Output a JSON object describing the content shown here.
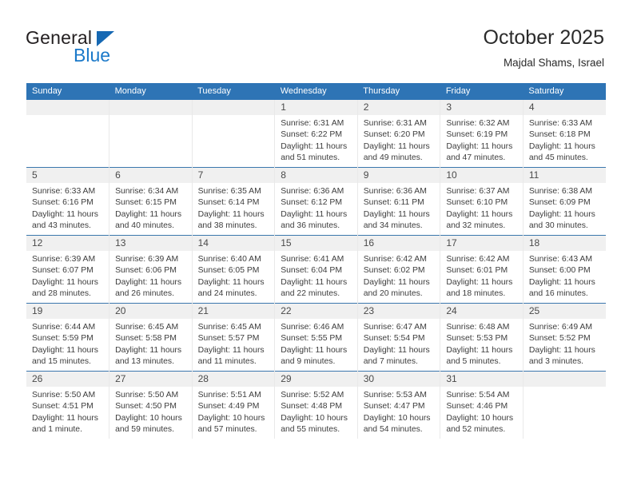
{
  "brand": {
    "name_top": "General",
    "name_bottom": "Blue",
    "triangle_color": "#1668b3",
    "blue_text_color": "#1b79c9"
  },
  "header": {
    "title": "October 2025",
    "subtitle": "Majdal Shams, Israel"
  },
  "theme": {
    "header_blue": "#2e74b5",
    "row_divider": "#3b77ad",
    "daynum_band": "#f0f0f0"
  },
  "weekdays": [
    "Sunday",
    "Monday",
    "Tuesday",
    "Wednesday",
    "Thursday",
    "Friday",
    "Saturday"
  ],
  "weeks": [
    [
      {
        "day": "",
        "blank": true
      },
      {
        "day": "",
        "blank": true
      },
      {
        "day": "",
        "blank": true
      },
      {
        "day": "1",
        "sunrise": "Sunrise: 6:31 AM",
        "sunset": "Sunset: 6:22 PM",
        "daylight_1": "Daylight: 11 hours",
        "daylight_2": "and 51 minutes."
      },
      {
        "day": "2",
        "sunrise": "Sunrise: 6:31 AM",
        "sunset": "Sunset: 6:20 PM",
        "daylight_1": "Daylight: 11 hours",
        "daylight_2": "and 49 minutes."
      },
      {
        "day": "3",
        "sunrise": "Sunrise: 6:32 AM",
        "sunset": "Sunset: 6:19 PM",
        "daylight_1": "Daylight: 11 hours",
        "daylight_2": "and 47 minutes."
      },
      {
        "day": "4",
        "sunrise": "Sunrise: 6:33 AM",
        "sunset": "Sunset: 6:18 PM",
        "daylight_1": "Daylight: 11 hours",
        "daylight_2": "and 45 minutes."
      }
    ],
    [
      {
        "day": "5",
        "sunrise": "Sunrise: 6:33 AM",
        "sunset": "Sunset: 6:16 PM",
        "daylight_1": "Daylight: 11 hours",
        "daylight_2": "and 43 minutes."
      },
      {
        "day": "6",
        "sunrise": "Sunrise: 6:34 AM",
        "sunset": "Sunset: 6:15 PM",
        "daylight_1": "Daylight: 11 hours",
        "daylight_2": "and 40 minutes."
      },
      {
        "day": "7",
        "sunrise": "Sunrise: 6:35 AM",
        "sunset": "Sunset: 6:14 PM",
        "daylight_1": "Daylight: 11 hours",
        "daylight_2": "and 38 minutes."
      },
      {
        "day": "8",
        "sunrise": "Sunrise: 6:36 AM",
        "sunset": "Sunset: 6:12 PM",
        "daylight_1": "Daylight: 11 hours",
        "daylight_2": "and 36 minutes."
      },
      {
        "day": "9",
        "sunrise": "Sunrise: 6:36 AM",
        "sunset": "Sunset: 6:11 PM",
        "daylight_1": "Daylight: 11 hours",
        "daylight_2": "and 34 minutes."
      },
      {
        "day": "10",
        "sunrise": "Sunrise: 6:37 AM",
        "sunset": "Sunset: 6:10 PM",
        "daylight_1": "Daylight: 11 hours",
        "daylight_2": "and 32 minutes."
      },
      {
        "day": "11",
        "sunrise": "Sunrise: 6:38 AM",
        "sunset": "Sunset: 6:09 PM",
        "daylight_1": "Daylight: 11 hours",
        "daylight_2": "and 30 minutes."
      }
    ],
    [
      {
        "day": "12",
        "sunrise": "Sunrise: 6:39 AM",
        "sunset": "Sunset: 6:07 PM",
        "daylight_1": "Daylight: 11 hours",
        "daylight_2": "and 28 minutes."
      },
      {
        "day": "13",
        "sunrise": "Sunrise: 6:39 AM",
        "sunset": "Sunset: 6:06 PM",
        "daylight_1": "Daylight: 11 hours",
        "daylight_2": "and 26 minutes."
      },
      {
        "day": "14",
        "sunrise": "Sunrise: 6:40 AM",
        "sunset": "Sunset: 6:05 PM",
        "daylight_1": "Daylight: 11 hours",
        "daylight_2": "and 24 minutes."
      },
      {
        "day": "15",
        "sunrise": "Sunrise: 6:41 AM",
        "sunset": "Sunset: 6:04 PM",
        "daylight_1": "Daylight: 11 hours",
        "daylight_2": "and 22 minutes."
      },
      {
        "day": "16",
        "sunrise": "Sunrise: 6:42 AM",
        "sunset": "Sunset: 6:02 PM",
        "daylight_1": "Daylight: 11 hours",
        "daylight_2": "and 20 minutes."
      },
      {
        "day": "17",
        "sunrise": "Sunrise: 6:42 AM",
        "sunset": "Sunset: 6:01 PM",
        "daylight_1": "Daylight: 11 hours",
        "daylight_2": "and 18 minutes."
      },
      {
        "day": "18",
        "sunrise": "Sunrise: 6:43 AM",
        "sunset": "Sunset: 6:00 PM",
        "daylight_1": "Daylight: 11 hours",
        "daylight_2": "and 16 minutes."
      }
    ],
    [
      {
        "day": "19",
        "sunrise": "Sunrise: 6:44 AM",
        "sunset": "Sunset: 5:59 PM",
        "daylight_1": "Daylight: 11 hours",
        "daylight_2": "and 15 minutes."
      },
      {
        "day": "20",
        "sunrise": "Sunrise: 6:45 AM",
        "sunset": "Sunset: 5:58 PM",
        "daylight_1": "Daylight: 11 hours",
        "daylight_2": "and 13 minutes."
      },
      {
        "day": "21",
        "sunrise": "Sunrise: 6:45 AM",
        "sunset": "Sunset: 5:57 PM",
        "daylight_1": "Daylight: 11 hours",
        "daylight_2": "and 11 minutes."
      },
      {
        "day": "22",
        "sunrise": "Sunrise: 6:46 AM",
        "sunset": "Sunset: 5:55 PM",
        "daylight_1": "Daylight: 11 hours",
        "daylight_2": "and 9 minutes."
      },
      {
        "day": "23",
        "sunrise": "Sunrise: 6:47 AM",
        "sunset": "Sunset: 5:54 PM",
        "daylight_1": "Daylight: 11 hours",
        "daylight_2": "and 7 minutes."
      },
      {
        "day": "24",
        "sunrise": "Sunrise: 6:48 AM",
        "sunset": "Sunset: 5:53 PM",
        "daylight_1": "Daylight: 11 hours",
        "daylight_2": "and 5 minutes."
      },
      {
        "day": "25",
        "sunrise": "Sunrise: 6:49 AM",
        "sunset": "Sunset: 5:52 PM",
        "daylight_1": "Daylight: 11 hours",
        "daylight_2": "and 3 minutes."
      }
    ],
    [
      {
        "day": "26",
        "sunrise": "Sunrise: 5:50 AM",
        "sunset": "Sunset: 4:51 PM",
        "daylight_1": "Daylight: 11 hours",
        "daylight_2": "and 1 minute."
      },
      {
        "day": "27",
        "sunrise": "Sunrise: 5:50 AM",
        "sunset": "Sunset: 4:50 PM",
        "daylight_1": "Daylight: 10 hours",
        "daylight_2": "and 59 minutes."
      },
      {
        "day": "28",
        "sunrise": "Sunrise: 5:51 AM",
        "sunset": "Sunset: 4:49 PM",
        "daylight_1": "Daylight: 10 hours",
        "daylight_2": "and 57 minutes."
      },
      {
        "day": "29",
        "sunrise": "Sunrise: 5:52 AM",
        "sunset": "Sunset: 4:48 PM",
        "daylight_1": "Daylight: 10 hours",
        "daylight_2": "and 55 minutes."
      },
      {
        "day": "30",
        "sunrise": "Sunrise: 5:53 AM",
        "sunset": "Sunset: 4:47 PM",
        "daylight_1": "Daylight: 10 hours",
        "daylight_2": "and 54 minutes."
      },
      {
        "day": "31",
        "sunrise": "Sunrise: 5:54 AM",
        "sunset": "Sunset: 4:46 PM",
        "daylight_1": "Daylight: 10 hours",
        "daylight_2": "and 52 minutes."
      },
      {
        "day": "",
        "blank": true
      }
    ]
  ]
}
